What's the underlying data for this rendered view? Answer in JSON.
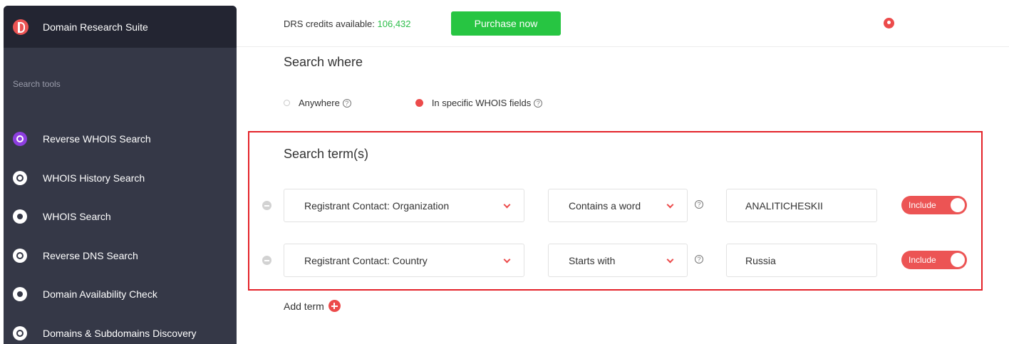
{
  "app": {
    "title": "Domain Research Suite"
  },
  "sidebar": {
    "section_label": "Search tools",
    "items": [
      {
        "label": "Reverse WHOIS Search",
        "icon": "reverse-whois-icon",
        "active": true
      },
      {
        "label": "WHOIS History Search",
        "icon": "history-icon",
        "active": false
      },
      {
        "label": "WHOIS Search",
        "icon": "user-circle-icon",
        "active": false
      },
      {
        "label": "Reverse DNS Search",
        "icon": "globe-icon",
        "active": false
      },
      {
        "label": "Domain Availability Check",
        "icon": "exclamation-icon",
        "active": false
      },
      {
        "label": "Domains & Subdomains Discovery",
        "icon": "discovery-icon",
        "active": false
      }
    ]
  },
  "topbar": {
    "credits_label": "DRS credits available:",
    "credits_value": "106,432",
    "purchase_label": "Purchase now",
    "user_icon": "user-icon"
  },
  "search_where": {
    "heading": "Search where",
    "options": [
      {
        "label": "Anywhere",
        "selected": false
      },
      {
        "label": "In specific WHOIS fields",
        "selected": true
      }
    ]
  },
  "search_terms": {
    "heading": "Search term(s)",
    "rows": [
      {
        "field": "Registrant Contact: Organization",
        "operator": "Contains a word",
        "value": "ANALITICHESKII",
        "toggle": "Include"
      },
      {
        "field": "Registrant Contact: Country",
        "operator": "Starts with",
        "value": "Russia",
        "toggle": "Include"
      }
    ],
    "add_label": "Add term"
  },
  "colors": {
    "accent": "#ec4b4b",
    "green": "#27c542",
    "sidebar": "#353847",
    "highlight": "#e42229"
  }
}
